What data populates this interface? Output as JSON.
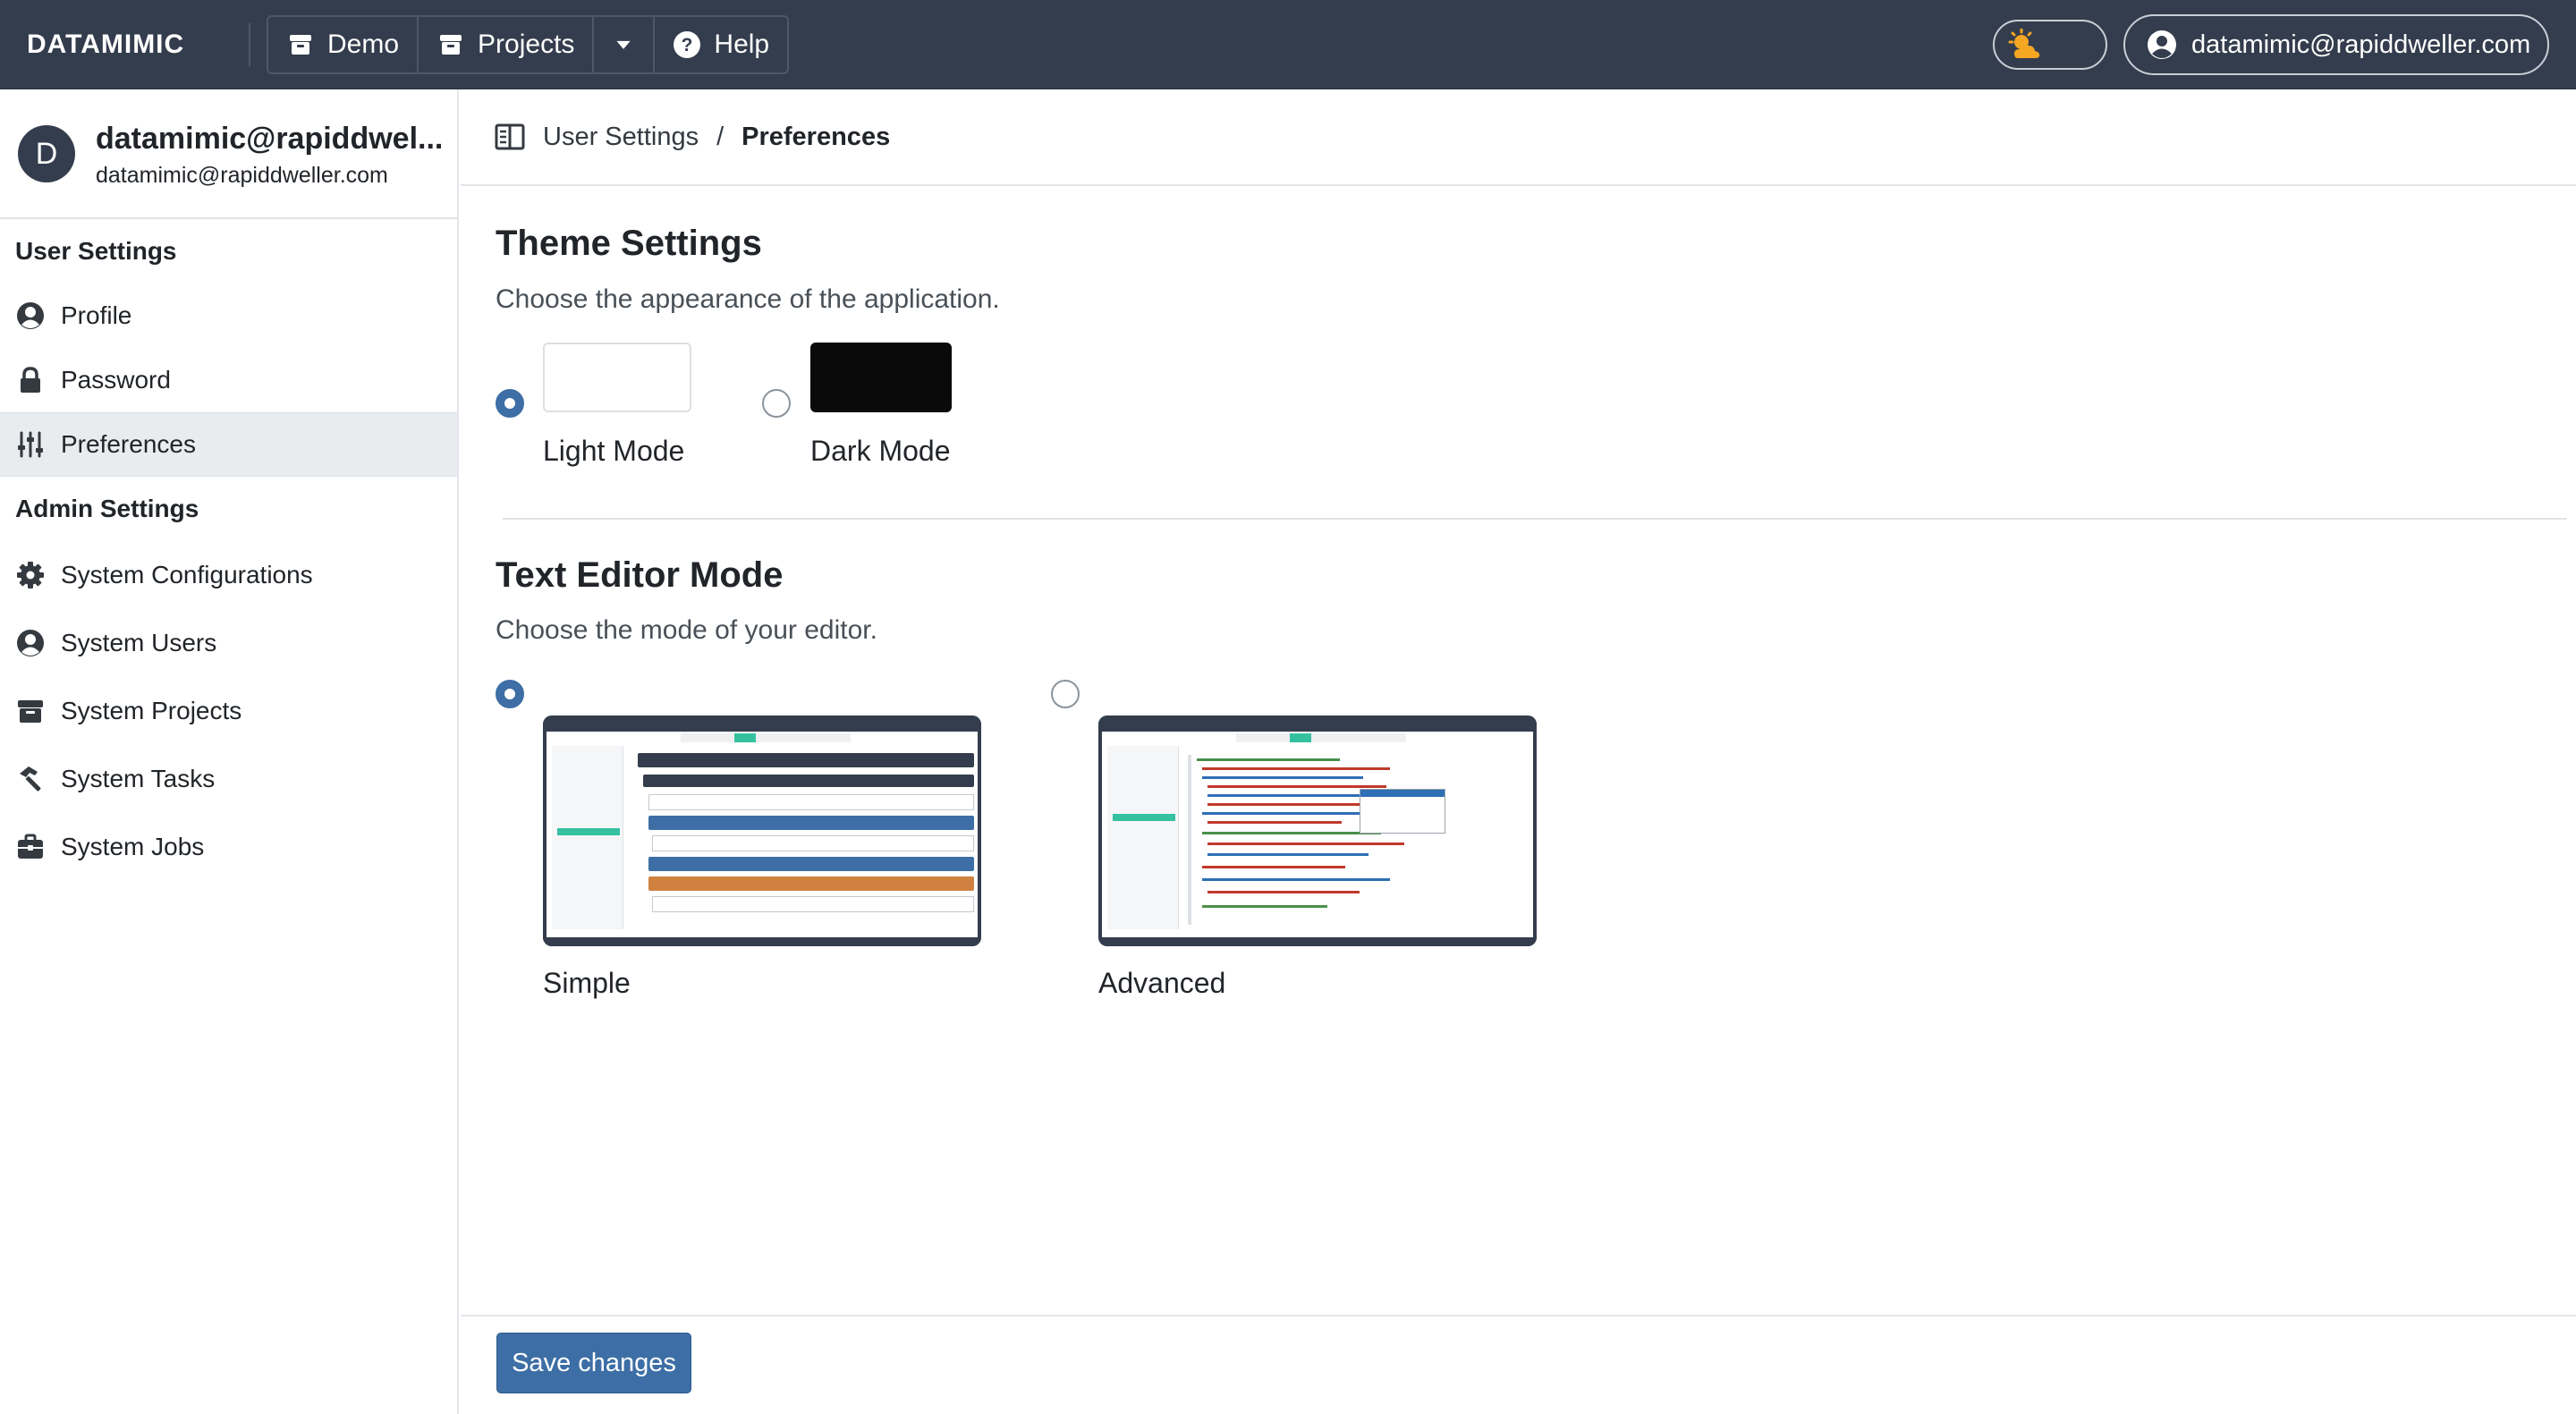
{
  "navbar": {
    "brand": "DATAMIMIC",
    "buttons": [
      {
        "label": "Demo",
        "icon": "archive-icon"
      },
      {
        "label": "Projects",
        "icon": "archive-icon"
      },
      {
        "label": "",
        "icon": "caret-down-icon"
      },
      {
        "label": "Help",
        "icon": "question-circle-icon"
      }
    ],
    "theme_toggle_icon": "sun-cloud-icon",
    "user_label": "datamimic@rapiddweller.com"
  },
  "sidebar": {
    "avatar_letter": "D",
    "profile_name": "datamimic@rapiddwel...",
    "profile_email": "datamimic@rapiddweller.com",
    "user_settings_heading": "User Settings",
    "user_items": [
      {
        "label": "Profile",
        "icon": "user-circle-icon"
      },
      {
        "label": "Password",
        "icon": "lock-icon"
      },
      {
        "label": "Preferences",
        "icon": "sliders-icon",
        "active": true
      }
    ],
    "admin_settings_heading": "Admin Settings",
    "admin_items": [
      {
        "label": "System Configurations",
        "icon": "gear-icon"
      },
      {
        "label": "System Users",
        "icon": "user-circle-icon"
      },
      {
        "label": "System Projects",
        "icon": "archive-icon"
      },
      {
        "label": "System Tasks",
        "icon": "hammer-icon"
      },
      {
        "label": "System Jobs",
        "icon": "briefcase-icon"
      }
    ]
  },
  "breadcrumb": {
    "icon": "sidebar-toggle-icon",
    "parent": "User Settings",
    "separator": "/",
    "current": "Preferences"
  },
  "theme_settings": {
    "title": "Theme Settings",
    "description": "Choose the appearance of the application.",
    "options": [
      {
        "label": "Light Mode",
        "selected": true,
        "swatch_color": "#ffffff"
      },
      {
        "label": "Dark Mode",
        "selected": false,
        "swatch_color": "#0a0a0a"
      }
    ]
  },
  "editor_mode": {
    "title": "Text Editor Mode",
    "description": "Choose the mode of your editor.",
    "options": [
      {
        "label": "Simple",
        "selected": true
      },
      {
        "label": "Advanced",
        "selected": false
      }
    ]
  },
  "footer": {
    "save_label": "Save changes"
  },
  "colors": {
    "navbar": "#343d4d",
    "accent": "#3d6ea5",
    "toggle_sun": "#f5a623"
  }
}
